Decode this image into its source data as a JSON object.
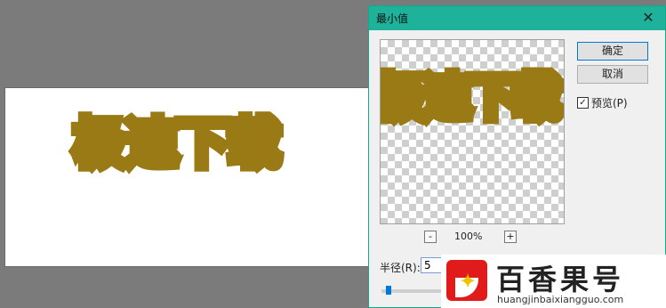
{
  "canvas_text": "极速下载",
  "dialog": {
    "title": "最小值",
    "ok_label": "确定",
    "cancel_label": "取消",
    "preview_check": "预览(P)",
    "preview_checked": true,
    "zoom_out": "-",
    "zoom_in": "+",
    "zoom_level": "100%",
    "radius_label": "半径(R):",
    "radius_value": "5",
    "preview_text": "极速下载"
  },
  "watermark": {
    "brand": "百香果号",
    "site": "huangjinbaixiangguo.com"
  },
  "colors": {
    "titlebar": "#1fb29a",
    "text_fill": "#9a7a14",
    "accent": "#0078d7"
  }
}
